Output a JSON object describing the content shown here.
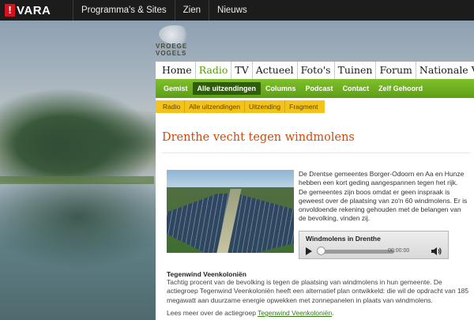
{
  "topbar": {
    "logo_mark": "!",
    "logo_text": "VARA",
    "nav": [
      "Programma's & Sites",
      "Zien",
      "Nieuws"
    ]
  },
  "brand": {
    "name": "VROEGE VOGELS"
  },
  "main_nav": {
    "items": [
      "Home",
      "Radio",
      "TV",
      "Actueel",
      "Foto's",
      "Tuinen",
      "Forum",
      "Nationale Vogel"
    ],
    "active": "Radio"
  },
  "sub_nav": {
    "items": [
      "Gemist",
      "Alle uitzendingen",
      "Columns",
      "Podcast",
      "Contact",
      "Zelf Gehoord"
    ],
    "active": "Alle uitzendingen"
  },
  "breadcrumb": [
    "Radio",
    "Alle uitzendingen",
    "Uitzending",
    "Fragment"
  ],
  "article": {
    "title": "Drenthe vecht tegen windmolens",
    "intro": "De Drentse gemeentes Borger-Odoorn en Aa en Hunze hebben een kort geding aangespannen tegen het rijk. De gemeentes zijn boos omdat er geen inspraak is geweest over de plaatsing van zo'n 60 windmolens. Er is onvoldoende rekening gehouden met de belangen van de bevolking, vinden zij.",
    "subheading": "Tegenwind Veenkoloniën",
    "body": "Tachtig procent van de bevolking is tegen de plaatsing van windmolens in hun gemeente. De actiegroep Tegenwind Veenkoloniën heeft een alternatief plan ontwikkeld: die wil de opdracht van 185 megawatt aan duurzame energie opwekken met zonnepanelen in plaats van windmolens.",
    "more_prefix": "Lees meer over de actiegroep ",
    "more_link": "Tegenwind Veenkoloniën",
    "more_suffix": "."
  },
  "player": {
    "title": "Windmolens in Drenthe",
    "time": "00:00:00",
    "progress": 0
  },
  "colors": {
    "accent_green": "#5e9e17",
    "title_orange": "#d04a0b",
    "crumb_yellow": "#f3c31b",
    "vara_red": "#d8111f"
  }
}
